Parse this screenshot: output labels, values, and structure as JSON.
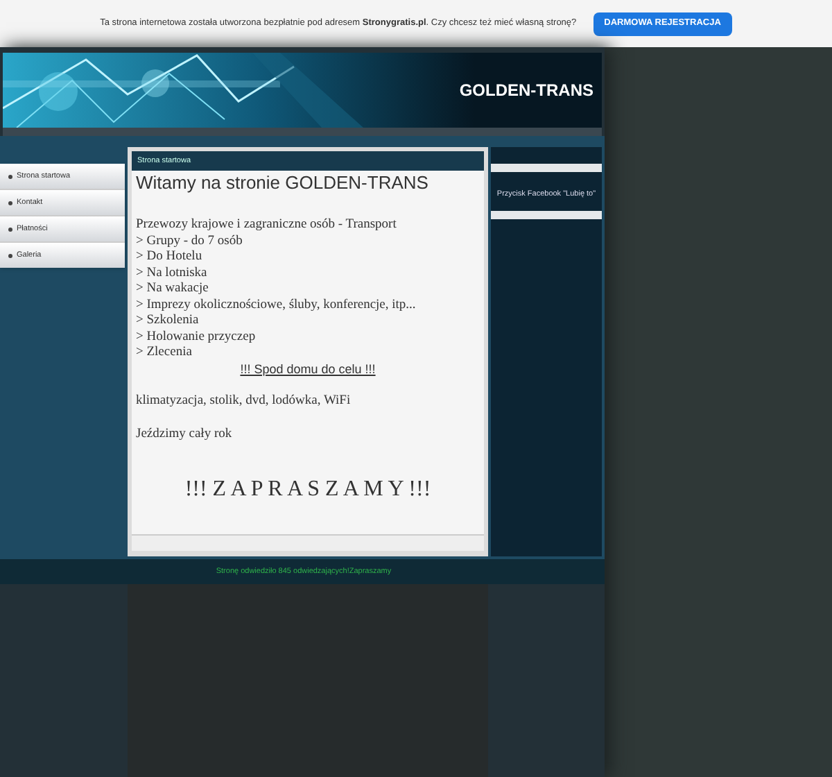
{
  "promo_bar": {
    "text": "Ta strona internetowa została utworzona bezpłatnie pod adresem **Stronygratis.pl**. Czy chcesz też mieć własną stronę?",
    "button": "DARMOWA REJESTRACJA"
  },
  "header": {
    "site_title": "GOLDEN-TRANS"
  },
  "nav": {
    "items": [
      {
        "label": "Strona startowa"
      },
      {
        "label": "Kontakt"
      },
      {
        "label": "Płatności"
      },
      {
        "label": "Galeria"
      }
    ]
  },
  "content": {
    "breadcrumb": "Strona startowa",
    "heading": "Witamy na stronie GOLDEN-TRANS",
    "intro": "Przewozy krajowe i zagraniczne osób - Transport",
    "list": [
      "> Grupy - do 7 osób",
      "> Do Hotelu",
      "> Na lotniska",
      "> Na wakacje",
      "> Imprezy okolicznościowe, śluby, konferencje, itp...",
      "> Szkolenia",
      "> Holowanie przyczep",
      "> Zlecenia"
    ],
    "slogan": "!!! Spod domu do celu !!!",
    "amenities": "klimatyzacja, stolik, dvd, lodówka, WiFi",
    "year_round": "Jeździmy cały rok",
    "invite": "!!! Z A P R A S Z A M Y !!!"
  },
  "right_column": {
    "facebook_button": "Przycisk Facebook \"Lubię to\""
  },
  "footer": {
    "visits": "Stronę odwiedziło 845 odwiedzających!Zapraszamy"
  }
}
